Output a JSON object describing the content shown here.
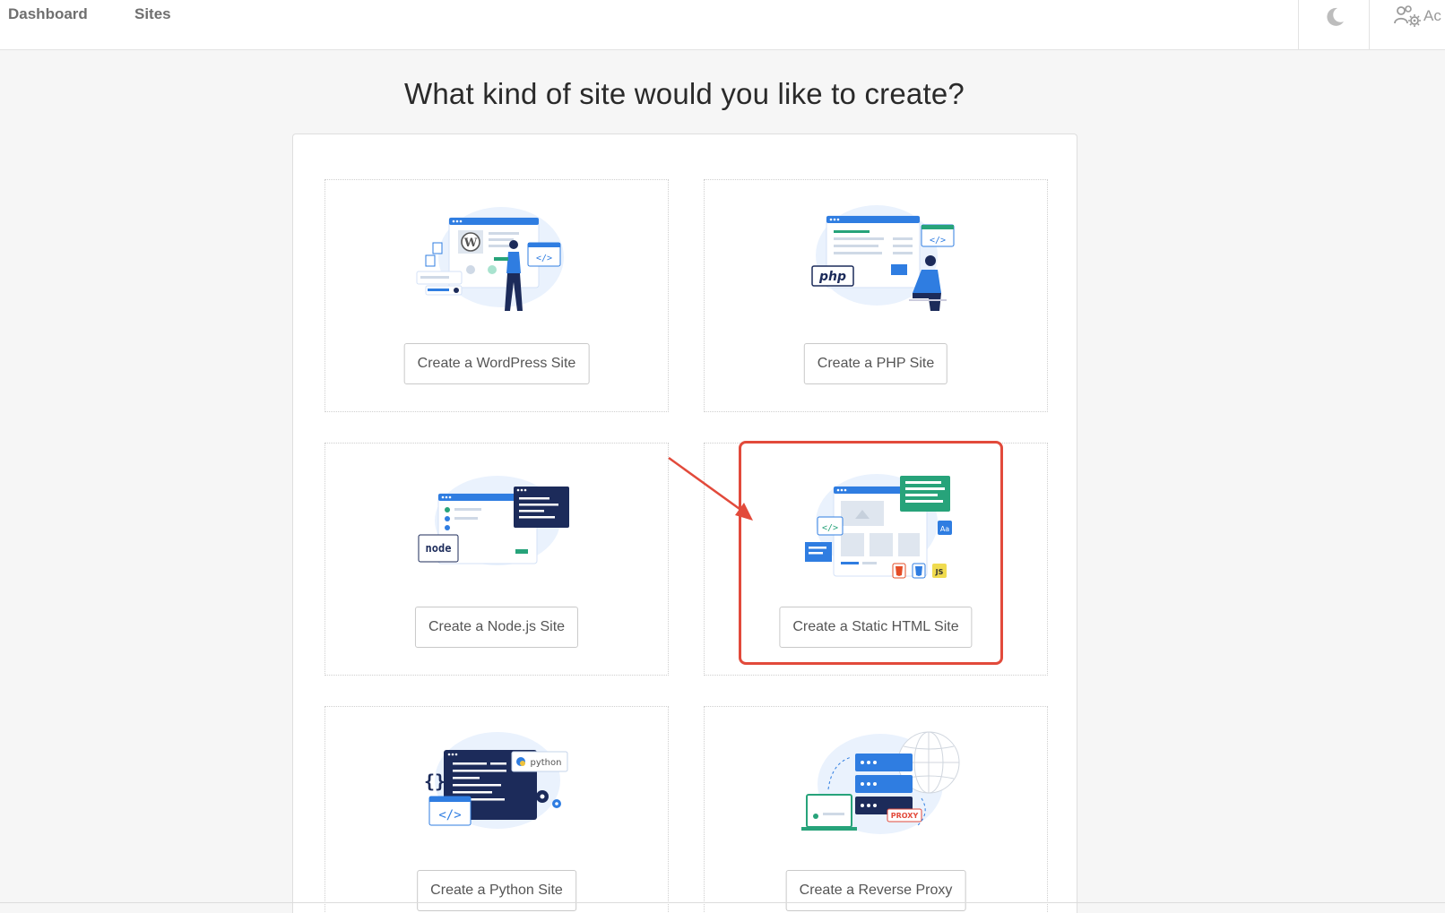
{
  "nav": {
    "dashboard": "Dashboard",
    "sites": "Sites",
    "account_partial": "Ac"
  },
  "title": "What kind of site would you like to create?",
  "cards": [
    {
      "label": "Create a WordPress Site",
      "illustration": "wordpress-illustration"
    },
    {
      "label": "Create a PHP Site",
      "illustration": "php-illustration",
      "badge": "php"
    },
    {
      "label": "Create a Node.js Site",
      "illustration": "nodejs-illustration",
      "badge": "node"
    },
    {
      "label": "Create a Static HTML Site",
      "illustration": "static-html-illustration",
      "badges": [
        "Aa",
        "JS"
      ]
    },
    {
      "label": "Create a Python Site",
      "illustration": "python-illustration",
      "badge": "python"
    },
    {
      "label": "Create a Reverse Proxy",
      "illustration": "reverse-proxy-illustration",
      "badge": "PROXY"
    }
  ],
  "icons": {
    "theme_toggle": "moon-icon",
    "account": "users-gear-icon"
  },
  "colors": {
    "accent_blue": "#2f7de1",
    "navy": "#1c2b5a",
    "highlight_red": "#e24a3b",
    "green": "#27a37a"
  }
}
